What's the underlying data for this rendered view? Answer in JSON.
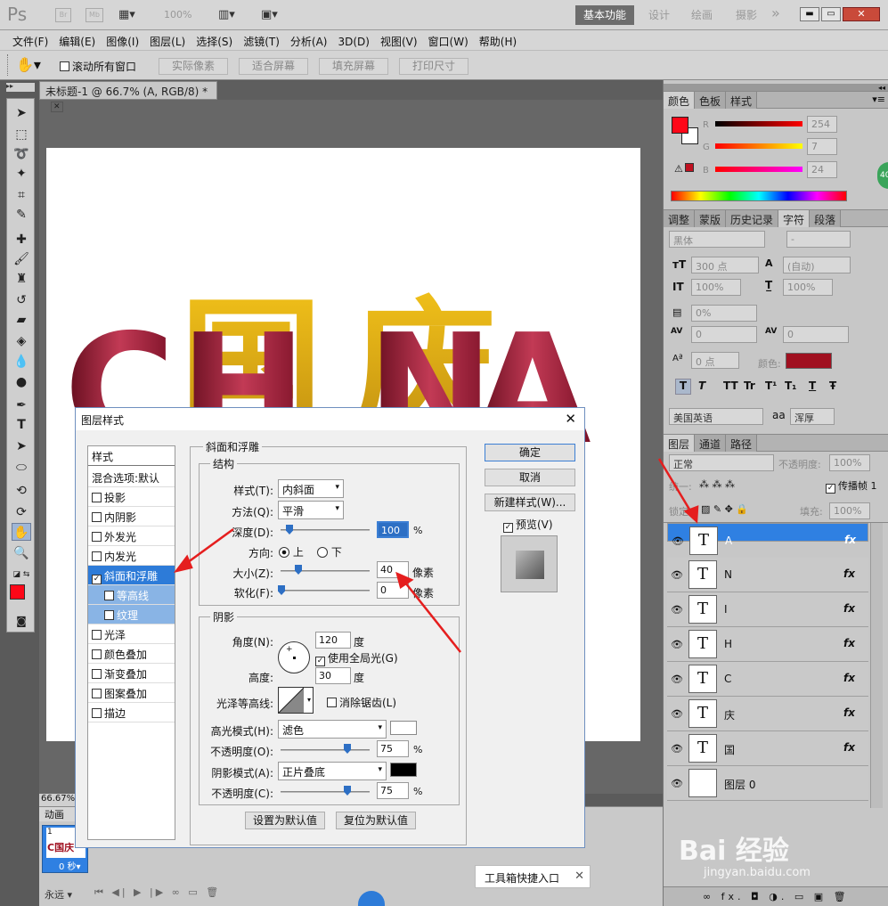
{
  "app": {
    "logo": "Ps",
    "zoom_display": "100%",
    "workspace_active": "基本功能",
    "workspaces": [
      "设计",
      "绘画",
      "摄影"
    ],
    "more": "»"
  },
  "menu": [
    "文件(F)",
    "编辑(E)",
    "图像(I)",
    "图层(L)",
    "选择(S)",
    "滤镜(T)",
    "分析(A)",
    "3D(D)",
    "视图(V)",
    "窗口(W)",
    "帮助(H)"
  ],
  "options": {
    "scroll_all": "滚动所有窗口",
    "buttons": [
      "实际像素",
      "适合屏幕",
      "填充屏幕",
      "打印尺寸"
    ]
  },
  "document": {
    "tab_title": "未标题-1 @ 66.7% (A, RGB/8) *",
    "zoom": "66.67%",
    "canvas_letters": [
      "C",
      "H",
      "国",
      "N",
      "庆",
      "A"
    ]
  },
  "color_panel": {
    "tabs": [
      "颜色",
      "色板",
      "样式"
    ],
    "r_label": "R",
    "g_label": "G",
    "b_label": "B",
    "r": "254",
    "g": "7",
    "b": "24",
    "fg": "#fe0718",
    "bg": "#ffffff"
  },
  "char_panel": {
    "tabs": [
      "调整",
      "蒙版",
      "历史记录",
      "字符",
      "段落"
    ],
    "font": "黑体",
    "font_style": "-",
    "size": "300 点",
    "leading": "(自动)",
    "v_scale": "100%",
    "h_scale": "100%",
    "tracking_pct": "0%",
    "kerning": "0",
    "tracking": "0",
    "baseline": "0 点",
    "color_label": "颜色:",
    "text_color": "#a01020",
    "styles": [
      "T",
      "T",
      "TT",
      "Tr",
      "T¹",
      "T₁",
      "T",
      "Ŧ"
    ],
    "language": "美国英语",
    "aa_icon": "aa",
    "antialias": "浑厚"
  },
  "layers_panel": {
    "tabs": [
      "图层",
      "通道",
      "路径"
    ],
    "blend": "正常",
    "opacity_label": "不透明度:",
    "opacity": "100%",
    "unify_label": "统一:",
    "propagate": "传播帧 1",
    "lock_label": "锁定:",
    "fill_label": "填充:",
    "fill": "100%",
    "layers": [
      {
        "name": "A",
        "thumb": "T",
        "fx": "fx",
        "selected": true
      },
      {
        "name": "N",
        "thumb": "T",
        "fx": "fx"
      },
      {
        "name": "I",
        "thumb": "T",
        "fx": "fx"
      },
      {
        "name": "H",
        "thumb": "T",
        "fx": "fx"
      },
      {
        "name": "C",
        "thumb": "T",
        "fx": "fx"
      },
      {
        "name": "庆",
        "thumb": "T",
        "fx": "fx"
      },
      {
        "name": "国",
        "thumb": "T",
        "fx": "fx"
      },
      {
        "name": "图层 0",
        "thumb": "",
        "fx": ""
      }
    ],
    "footer": "∞ fx. ◘ ◑. ▭ ▣ 🗑"
  },
  "animation": {
    "tab": "动画",
    "frame_number": "1",
    "frame_text": "C国庆",
    "frame_time": "0 秒▾",
    "loop": "永远"
  },
  "dialog": {
    "title": "图层样式",
    "styles_header": "样式",
    "blend_default": "混合选项:默认",
    "styles": [
      {
        "label": "投影",
        "checked": false,
        "kind": "normal"
      },
      {
        "label": "内阴影",
        "checked": false,
        "kind": "normal"
      },
      {
        "label": "外发光",
        "checked": false,
        "kind": "normal"
      },
      {
        "label": "内发光",
        "checked": false,
        "kind": "normal"
      },
      {
        "label": "斜面和浮雕",
        "checked": true,
        "kind": "hl"
      },
      {
        "label": "等高线",
        "checked": false,
        "kind": "sub"
      },
      {
        "label": "纹理",
        "checked": false,
        "kind": "sub"
      },
      {
        "label": "光泽",
        "checked": false,
        "kind": "normal"
      },
      {
        "label": "颜色叠加",
        "checked": false,
        "kind": "normal"
      },
      {
        "label": "渐变叠加",
        "checked": false,
        "kind": "normal"
      },
      {
        "label": "图案叠加",
        "checked": false,
        "kind": "normal"
      },
      {
        "label": "描边",
        "checked": false,
        "kind": "normal"
      }
    ],
    "section": "斜面和浮雕",
    "structure": "结构",
    "style_label": "样式(T):",
    "style_value": "内斜面",
    "method_label": "方法(Q):",
    "method_value": "平滑",
    "depth_label": "深度(D):",
    "depth_value": "100",
    "depth_unit": "%",
    "depth_pct": 0.1,
    "direction_label": "方向:",
    "dir_up": "上",
    "dir_down": "下",
    "size_label": "大小(Z):",
    "size_value": "40",
    "size_unit": "像素",
    "size_pct": 0.2,
    "soften_label": "软化(F):",
    "soften_value": "0",
    "soften_unit": "像素",
    "shading": "阴影",
    "angle_label": "角度(N):",
    "angle_value": "120",
    "angle_unit": "度",
    "global_light": "使用全局光(G)",
    "altitude_label": "高度:",
    "altitude_value": "30",
    "altitude_unit": "度",
    "gloss_label": "光泽等高线:",
    "antialias": "消除锯齿(L)",
    "highlight_label": "高光模式(H):",
    "highlight_value": "滤色",
    "hl_opacity_label": "不透明度(O):",
    "hl_opacity": "75",
    "pct": "%",
    "shadow_label": "阴影模式(A):",
    "shadow_value": "正片叠底",
    "sh_opacity_label": "不透明度(C):",
    "sh_opacity": "75",
    "make_default": "设置为默认值",
    "reset_default": "复位为默认值",
    "ok": "确定",
    "cancel": "取消",
    "new_style": "新建样式(W)...",
    "preview": "预览(V)"
  },
  "tooltip": "工具箱快捷入口",
  "watermark": {
    "brand": "Bai  经验",
    "url": "jingyan.baidu.com"
  }
}
